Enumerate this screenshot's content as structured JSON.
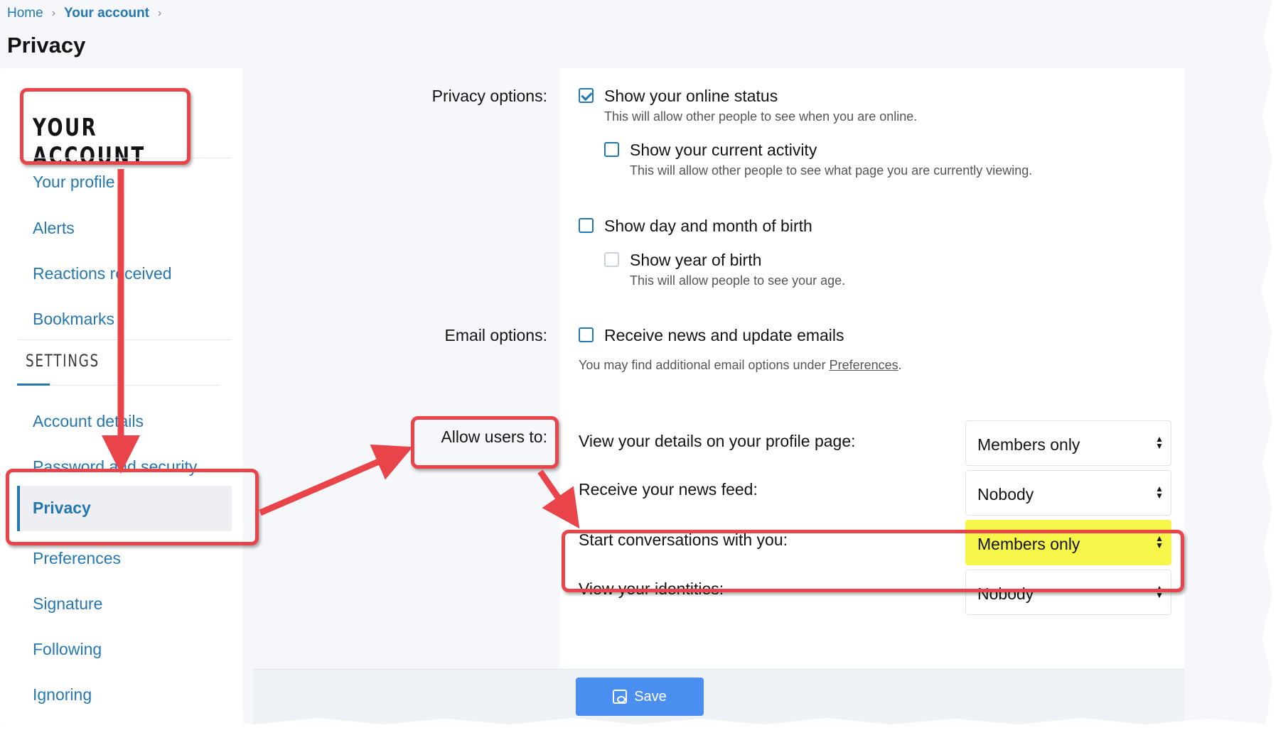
{
  "breadcrumb": {
    "home": "Home",
    "account": "Your account",
    "sep": "›"
  },
  "page_title": "Privacy",
  "sidebar": {
    "account_heading": "YOUR ACCOUNT",
    "account_items": [
      {
        "label": "Your profile"
      },
      {
        "label": "Alerts"
      },
      {
        "label": "Reactions received"
      },
      {
        "label": "Bookmarks"
      }
    ],
    "settings_heading": "SETTINGS",
    "settings_items": [
      {
        "label": "Account details"
      },
      {
        "label": "Password and security"
      },
      {
        "label": "Privacy",
        "active": true
      },
      {
        "label": "Preferences"
      },
      {
        "label": "Signature"
      },
      {
        "label": "Following"
      },
      {
        "label": "Ignoring"
      }
    ]
  },
  "form": {
    "privacy_options_label": "Privacy options:",
    "online_status": {
      "label": "Show your online status",
      "hint": "This will allow other people to see when you are online.",
      "checked": true
    },
    "current_activity": {
      "label": "Show your current activity",
      "hint": "This will allow other people to see what page you are currently viewing.",
      "checked": false
    },
    "dob": {
      "label": "Show day and month of birth",
      "checked": false
    },
    "year_of_birth": {
      "label": "Show year of birth",
      "hint": "This will allow people to see your age.",
      "checked": false,
      "disabled": true
    },
    "email_options_label": "Email options:",
    "news_emails": {
      "label": "Receive news and update emails",
      "checked": false
    },
    "email_hint_prefix": "You may find additional email options under ",
    "email_hint_link": "Preferences",
    "email_hint_suffix": ".",
    "allow_users_label": "Allow users to:",
    "allow_rows": [
      {
        "label": "View your details on your profile page:",
        "value": "Members only"
      },
      {
        "label": "Receive your news feed:",
        "value": "Nobody"
      },
      {
        "label": "Start conversations with you:",
        "value": "Members only",
        "highlighted": true
      },
      {
        "label": "View your identities:",
        "value": "Nobody"
      }
    ],
    "save_label": "Save"
  },
  "colors": {
    "link": "#2577b1",
    "annotation": "#e8444a",
    "highlight": "#f5f54a",
    "button": "#4a8ff0"
  }
}
